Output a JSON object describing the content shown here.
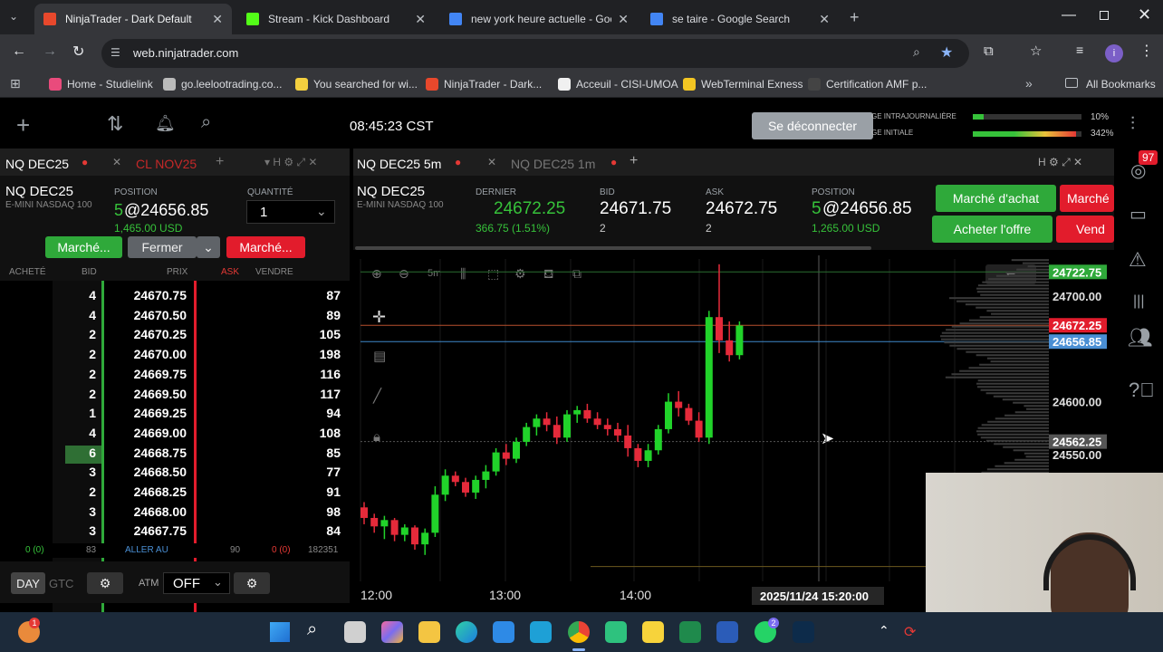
{
  "browser": {
    "tabs": [
      {
        "title": "NinjaTrader - Dark Default",
        "active": true,
        "color": "#e8482c"
      },
      {
        "title": "Stream - Kick Dashboard",
        "active": false,
        "color": "#53fc18"
      },
      {
        "title": "new york heure actuelle - Goog",
        "active": false,
        "color": "#4285f4"
      },
      {
        "title": "se taire - Google Search",
        "active": false,
        "color": "#4285f4"
      }
    ],
    "url": "web.ninjatrader.com",
    "bookmarks": [
      "Home - Studielink",
      "go.leelootrading.co...",
      "You searched for wi...",
      "NinjaTrader - Dark...",
      "Acceuil - CISI-UMOA",
      "WebTerminal Exness",
      "Certification AMF p..."
    ],
    "all_bookmarks": "All Bookmarks",
    "profile_initial": "i"
  },
  "app": {
    "clock": "08:45:23 CST",
    "disconnect": "Se déconnecter",
    "meter": {
      "intraday_label": "GE INTRAJOURNALIÈRE",
      "intraday_value": "10%",
      "initial_label": "GE INITIALE",
      "initial_value": "342%",
      "intraday_frac": 0.1,
      "initial_frac": 0.95
    },
    "badge_count": "97"
  },
  "left": {
    "tabs": [
      "NQ DEC25",
      "CL NOV25"
    ],
    "symbol": "NQ DEC25",
    "subtitle": "E-MINI NASDAQ 100",
    "position_label": "POSITION",
    "position_qty": "5",
    "position_price": "@24656.85",
    "position_pnl": "1,465.00 USD",
    "qty_label": "QUANTITÉ",
    "qty_value": "1",
    "btn_buy": "Marché...",
    "btn_close": "Fermer",
    "btn_sell": "Marché...",
    "headers": {
      "bought": "ACHETÉ",
      "bid": "BID",
      "price": "PRIX",
      "ask": "ASK",
      "sold": "VENDRE"
    },
    "rows": [
      {
        "bid": "4",
        "price": "24670.75",
        "sold": "87"
      },
      {
        "bid": "4",
        "price": "24670.50",
        "sold": "89"
      },
      {
        "bid": "2",
        "price": "24670.25",
        "sold": "105"
      },
      {
        "bid": "2",
        "price": "24670.00",
        "sold": "198"
      },
      {
        "bid": "2",
        "price": "24669.75",
        "sold": "116"
      },
      {
        "bid": "2",
        "price": "24669.50",
        "sold": "117"
      },
      {
        "bid": "1",
        "price": "24669.25",
        "sold": "94"
      },
      {
        "bid": "4",
        "price": "24669.00",
        "sold": "108"
      },
      {
        "bid": "6",
        "price": "24668.75",
        "sold": "85"
      },
      {
        "bid": "3",
        "price": "24668.50",
        "sold": "77"
      },
      {
        "bid": "2",
        "price": "24668.25",
        "sold": "91"
      },
      {
        "bid": "3",
        "price": "24668.00",
        "sold": "98"
      },
      {
        "bid": "3",
        "price": "24667.75",
        "sold": "84"
      }
    ],
    "footer": {
      "bought": "0 (0)",
      "bid_total": "83",
      "goto": "ALLER AU",
      "ask_total": "90",
      "sold_left": "0 (0)",
      "sold_total": "182351"
    },
    "bottom": {
      "day": "DAY",
      "gtc": "GTC",
      "atm": "ATM",
      "atm_value": "OFF"
    }
  },
  "right": {
    "tabs": [
      "NQ DEC25 5m",
      "NQ DEC25 1m"
    ],
    "symbol": "NQ DEC25",
    "subtitle": "E-MINI NASDAQ 100",
    "last_label": "DERNIER",
    "last_value": "24672.25",
    "last_change": "366.75 (1.51%)",
    "bid_label": "BID",
    "bid_value": "24671.75",
    "bid_size": "2",
    "ask_label": "ASK",
    "ask_value": "24672.75",
    "ask_size": "2",
    "pos_label": "POSITION",
    "pos_qty": "5",
    "pos_price": "@24656.85",
    "pos_pnl": "1,265.00 USD",
    "btn_market_buy": "Marché d'achat",
    "btn_market_sell": "Marché",
    "btn_buy_offer": "Acheter l'offre",
    "btn_sell": "Vend",
    "chart_tool_label": "5m"
  },
  "chart_data": {
    "type": "candlestick",
    "x_ticks": [
      "12:00",
      "13:00",
      "14:00",
      "2025/11/24 15:20:00"
    ],
    "y_ticks": [
      24700.0,
      24600.0,
      24550.0
    ],
    "y_tick_labels": [
      "24700.00",
      "24600.00",
      "24550.00"
    ],
    "price_tags": [
      {
        "label": "24722.75",
        "value": 24722.75,
        "color": "#2fa93a"
      },
      {
        "label": "24672.25",
        "value": 24672.25,
        "color": "#e21c2c"
      },
      {
        "label": "24656.85",
        "value": 24656.85,
        "color": "#4a8fd4"
      },
      {
        "label": "24562.25",
        "value": 24562.25,
        "color": "#555555"
      }
    ],
    "ylim": [
      24430,
      24735
    ],
    "candles": [
      {
        "o": 24500,
        "h": 24505,
        "l": 24484,
        "c": 24490
      },
      {
        "o": 24490,
        "h": 24494,
        "l": 24476,
        "c": 24482
      },
      {
        "o": 24482,
        "h": 24492,
        "l": 24470,
        "c": 24488
      },
      {
        "o": 24488,
        "h": 24490,
        "l": 24468,
        "c": 24474
      },
      {
        "o": 24474,
        "h": 24484,
        "l": 24468,
        "c": 24481
      },
      {
        "o": 24481,
        "h": 24483,
        "l": 24460,
        "c": 24465
      },
      {
        "o": 24465,
        "h": 24480,
        "l": 24455,
        "c": 24476
      },
      {
        "o": 24476,
        "h": 24520,
        "l": 24472,
        "c": 24512
      },
      {
        "o": 24512,
        "h": 24536,
        "l": 24506,
        "c": 24530
      },
      {
        "o": 24530,
        "h": 24534,
        "l": 24520,
        "c": 24524
      },
      {
        "o": 24524,
        "h": 24528,
        "l": 24510,
        "c": 24514
      },
      {
        "o": 24514,
        "h": 24530,
        "l": 24508,
        "c": 24526
      },
      {
        "o": 24526,
        "h": 24540,
        "l": 24518,
        "c": 24534
      },
      {
        "o": 24534,
        "h": 24556,
        "l": 24530,
        "c": 24552
      },
      {
        "o": 24552,
        "h": 24560,
        "l": 24540,
        "c": 24546
      },
      {
        "o": 24546,
        "h": 24566,
        "l": 24542,
        "c": 24562
      },
      {
        "o": 24562,
        "h": 24580,
        "l": 24558,
        "c": 24576
      },
      {
        "o": 24576,
        "h": 24588,
        "l": 24568,
        "c": 24584
      },
      {
        "o": 24584,
        "h": 24590,
        "l": 24572,
        "c": 24578
      },
      {
        "o": 24578,
        "h": 24586,
        "l": 24560,
        "c": 24566
      },
      {
        "o": 24566,
        "h": 24592,
        "l": 24562,
        "c": 24588
      },
      {
        "o": 24588,
        "h": 24596,
        "l": 24580,
        "c": 24592
      },
      {
        "o": 24592,
        "h": 24598,
        "l": 24580,
        "c": 24584
      },
      {
        "o": 24584,
        "h": 24590,
        "l": 24574,
        "c": 24578
      },
      {
        "o": 24578,
        "h": 24584,
        "l": 24568,
        "c": 24574
      },
      {
        "o": 24574,
        "h": 24580,
        "l": 24562,
        "c": 24568
      },
      {
        "o": 24568,
        "h": 24578,
        "l": 24548,
        "c": 24556
      },
      {
        "o": 24556,
        "h": 24560,
        "l": 24538,
        "c": 24544
      },
      {
        "o": 24544,
        "h": 24560,
        "l": 24538,
        "c": 24554
      },
      {
        "o": 24554,
        "h": 24578,
        "l": 24550,
        "c": 24574
      },
      {
        "o": 24574,
        "h": 24608,
        "l": 24570,
        "c": 24600
      },
      {
        "o": 24600,
        "h": 24610,
        "l": 24586,
        "c": 24594
      },
      {
        "o": 24594,
        "h": 24598,
        "l": 24578,
        "c": 24582
      },
      {
        "o": 24582,
        "h": 24590,
        "l": 24562,
        "c": 24566
      },
      {
        "o": 24566,
        "h": 24686,
        "l": 24560,
        "c": 24680
      },
      {
        "o": 24680,
        "h": 24730,
        "l": 24646,
        "c": 24658
      },
      {
        "o": 24658,
        "h": 24676,
        "l": 24638,
        "c": 24644
      },
      {
        "o": 24644,
        "h": 24676,
        "l": 24640,
        "c": 24672
      }
    ]
  },
  "taskbar": {
    "notif": "1",
    "whatsapp_badge": "2"
  }
}
